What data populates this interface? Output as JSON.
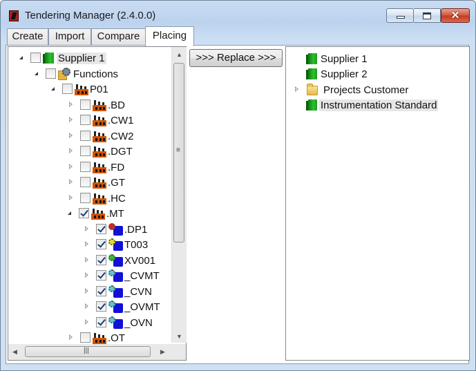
{
  "window": {
    "title": "Tendering Manager (2.4.0.0)"
  },
  "tabs": [
    {
      "label": "Create"
    },
    {
      "label": "Import"
    },
    {
      "label": "Compare"
    },
    {
      "label": "Placing",
      "active": true
    }
  ],
  "left_tree": [
    {
      "label": "Supplier 1"
    },
    {
      "label": "Functions"
    },
    {
      "label": "P01"
    },
    {
      "label": ".BD"
    },
    {
      "label": ".CW1"
    },
    {
      "label": ".CW2"
    },
    {
      "label": ".DGT"
    },
    {
      "label": ".FD"
    },
    {
      "label": ".GT"
    },
    {
      "label": ".HC"
    },
    {
      "label": ".MT"
    },
    {
      "label": ".DP1"
    },
    {
      "label": "T003"
    },
    {
      "label": "XV001"
    },
    {
      "label": "_CVMT"
    },
    {
      "label": "_CVN"
    },
    {
      "label": "_OVMT"
    },
    {
      "label": "_OVN"
    },
    {
      "label": ".OT"
    }
  ],
  "replace_button": {
    "label": ">>> Replace >>>"
  },
  "right_tree": [
    {
      "label": "Supplier 1"
    },
    {
      "label": "Supplier  2"
    },
    {
      "label": "Projects Customer"
    },
    {
      "label": "Instrumentation Standard"
    }
  ],
  "colors": {
    "book_green": "#2fbf2f",
    "factory_orange": "#d35400",
    "device_blue": "#1010d8",
    "device_red_dot": "#e02020",
    "device_yellow_dot": "#e8e020",
    "device_green_dot": "#30c030",
    "device_cyan_dot": "#60c8d8"
  }
}
